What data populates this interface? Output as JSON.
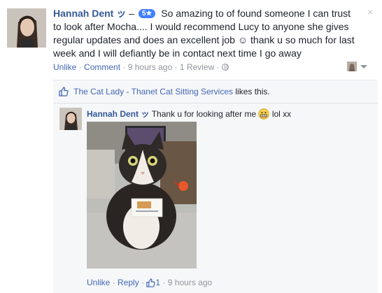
{
  "review": {
    "author": "Hannah Dent",
    "author_suffix": "ッ",
    "separator": "–",
    "rating_badge": "5★",
    "text": "So amazing to of found someone I can trust to look after Mocha.... I would recommend Lucy to anyone she gives regular updates and does an excellent job ☺ thank u so much for last week and I will defiantly be in contact next time I go away",
    "actions": {
      "unlike": "Unlike",
      "dot1": "·",
      "comment": "Comment",
      "dot2": "·",
      "time": "9 hours ago",
      "dot3": "·",
      "review_count": "1 Review",
      "dot4": "·"
    },
    "close_glyph": "×"
  },
  "likes": {
    "page_name": "The Cat Lady - Thanet Cat Sitting Services",
    "suffix": "likes this."
  },
  "comment": {
    "author": "Hannah Dent",
    "author_suffix": "ッ",
    "text_before": "Thank u for looking after me",
    "text_after": "lol xx",
    "actions": {
      "unlike": "Unlike",
      "dot1": "·",
      "reply": "Reply",
      "dot2": "·",
      "like_count": "1",
      "dot3": "·",
      "time": "9 hours ago"
    }
  },
  "colors": {
    "link": "#365899",
    "badge": "#4080ff",
    "meta": "#90949c",
    "panel": "#f6f7f9"
  },
  "icons": [
    "like-icon",
    "globe-icon",
    "grin-emoji-icon",
    "chevron-down-icon",
    "close-icon"
  ]
}
